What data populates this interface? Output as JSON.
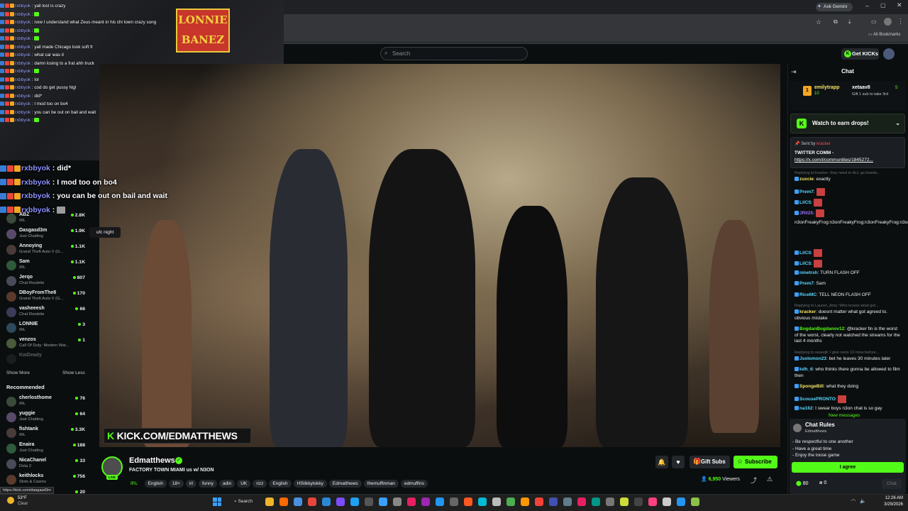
{
  "browser": {
    "ask_gemini": "Ask Gemini",
    "bookmarks_label": "All Bookmarks"
  },
  "kick": {
    "search_placeholder": "Search",
    "get_kicks": "Get KICKs"
  },
  "overlay_chat": [
    {
      "user": "rxbbyok",
      "text": "yall lost is crazy"
    },
    {
      "user": "rxbbyok",
      "text": ""
    },
    {
      "user": "rxbbyok",
      "text": "now I understand what Zeus meant in his chi town crazy song"
    },
    {
      "user": "rxbbyok",
      "text": ""
    },
    {
      "user": "rxbbyok",
      "text": ""
    },
    {
      "user": "rxbbyok",
      "text": "yall made Chicago look soft fr"
    },
    {
      "user": "rxbbyok",
      "text": "what car was it"
    },
    {
      "user": "rxbbyok",
      "text": "damn losing to a frat ahh truck"
    },
    {
      "user": "rxbbyok",
      "text": ""
    },
    {
      "user": "rxbbyok",
      "text": "lol"
    },
    {
      "user": "rxbbyok",
      "text": "cod do get pussy Ngl"
    },
    {
      "user": "rxbbyok",
      "text": "did*"
    },
    {
      "user": "rxbbyok",
      "text": "I mod too on bo4"
    },
    {
      "user": "rxbbyok",
      "text": "you can be out on bail and wait"
    },
    {
      "user": "rxbbyok",
      "text": ""
    }
  ],
  "poster_text": "LONNIE BANEZ",
  "overlay_big": [
    {
      "user": "rxbbyok",
      "text": "did*"
    },
    {
      "user": "rxbbyok",
      "text": "I mod too on bo4"
    },
    {
      "user": "rxbbyok",
      "text": "you can be out on bail and wait"
    },
    {
      "user": "rxbbyok",
      "text": ""
    }
  ],
  "sidebar": {
    "channels": [
      {
        "name": "ABZ",
        "category": "IRL",
        "viewers": "2.8K"
      },
      {
        "name": "Dasgasd3m",
        "category": "Just Chatting",
        "viewers": "1.9K"
      },
      {
        "name": "Annoying",
        "category": "Grand Theft Auto V (G...",
        "viewers": "1.1K"
      },
      {
        "name": "Sam",
        "category": "IRL",
        "viewers": "1.1K"
      },
      {
        "name": "Jerqo",
        "category": "Chat Roulette",
        "viewers": "807"
      },
      {
        "name": "DBoyFromThe8",
        "category": "Grand Theft Auto V (G...",
        "viewers": "170"
      },
      {
        "name": "vasheeesh",
        "category": "Chat Roulette",
        "viewers": "66"
      },
      {
        "name": "LONNIE",
        "category": "IRL",
        "viewers": "3"
      },
      {
        "name": "venzos",
        "category": "Call Of Duty: Modern War...",
        "viewers": "1"
      },
      {
        "name": "KaiDeady",
        "category": "",
        "viewers": ""
      }
    ],
    "show_more": "Show More",
    "show_less": "Show Less",
    "recommended_title": "Recommended",
    "recommended": [
      {
        "name": "cherlosthome",
        "category": "IRL",
        "viewers": "76"
      },
      {
        "name": "yuggie",
        "category": "Just Chatting",
        "viewers": "64"
      },
      {
        "name": "fishtank",
        "category": "IRL",
        "viewers": "3.3K"
      },
      {
        "name": "Enaira",
        "category": "Just Chatting",
        "viewers": "188"
      },
      {
        "name": "NicaChanel",
        "category": "Dota 2",
        "viewers": "33"
      },
      {
        "name": "keithlocks",
        "category": "Slots & Casino",
        "viewers": "756"
      },
      {
        "name": "",
        "category": "",
        "viewers": "20"
      }
    ]
  },
  "tooltip": "ufc night",
  "video": {
    "watermark_k": "K",
    "watermark": "KICK.COM/EDMATTHEWS"
  },
  "stream": {
    "streamer": "Edmatthews",
    "live": "LIVE",
    "title": "FACTORY TOWN MIAMI us w/ N3ON",
    "category": "IRL",
    "tags": [
      "English",
      "18+",
      "irl",
      "funny",
      "adin",
      "UK",
      "rizz",
      "English",
      "HStikkytokky",
      "Edmatthews",
      "themuffinman",
      "edmuffins"
    ],
    "gift_subs": "Gift Subs",
    "subscribe": "Subscribe",
    "viewers_count": "6,950",
    "viewers_label": "Viewers"
  },
  "chat": {
    "title": "Chat",
    "gift_user": "emilytrapp",
    "gift_count": "10",
    "gift_target": "xetaav8",
    "gift_num": "5",
    "gift_text": "Gift 1 sub to take 3rd",
    "drops": "Watch to earn drops!",
    "pinned_sent_by": "Sent by",
    "pinned_user": "kracker",
    "pinned_text": "TWITTER COMM -",
    "pinned_link": "https://x.com/i/communities/1845272...",
    "messages": [
      {
        "reply": "Replying to kracker: they need to ALL go beside..."
      },
      {
        "user": "zuxcie",
        "color": "#f5e663",
        "text": "exactly"
      },
      {
        "user": "Prem7",
        "color": "#58d8ff",
        "text": ""
      },
      {
        "user": "LilCS",
        "color": "#58d8ff",
        "text": ""
      },
      {
        "user": "JR025",
        "color": "#9b6bff",
        "text": ""
      },
      {
        "text": "n3onFreakyFrog:n3onFreakyFrog:n3onFreakyFrog:n3onFreakyFrog:n3onFreakyFrog:n3onFreakyFrog:n3onFreakyFrog:n3onFreakyFrog:n3onFreakyFrog:"
      },
      {
        "user": "LilCS",
        "color": "#58d8ff",
        "text": ""
      },
      {
        "user": "LilCS",
        "color": "#58d8ff",
        "text": ""
      },
      {
        "user": "ninetrsh",
        "color": "#58d8ff",
        "text": "TURN FLASH OFF"
      },
      {
        "user": "Prem7",
        "color": "#58d8ff",
        "text": "Sam"
      },
      {
        "user": "RiceMC",
        "color": "#58d8ff",
        "text": "TELL NEON FLASH OFF"
      },
      {
        "reply": "Replying to Lauren_Amy: Who knows what get..."
      },
      {
        "user": "kracker",
        "color": "#f5e663",
        "text": "doesnt matter what got agreed to. obvious mistake"
      },
      {
        "user": "BogdanBogdanov12",
        "color": "#53fc18",
        "text": "@kracker fin is the worst of the worst, clearly not watched the streams for the last 4 months"
      },
      {
        "reply": "Replying to seanqlt: I give neon 10 mins before..."
      },
      {
        "user": "Jsolomon23",
        "color": "#58d8ff",
        "text": "bet he leaves 30 minutes later"
      },
      {
        "user": "kdh_6",
        "color": "#58d8ff",
        "text": "who thinks there gonna be allowed to film then"
      },
      {
        "user": "SpongeBill",
        "color": "#f5e663",
        "text": "what they doing"
      },
      {
        "user": "ScousePRONTO",
        "color": "#58d8ff",
        "text": ""
      },
      {
        "user": "na162",
        "color": "#58d8ff",
        "text": "I swear boys n3on chat is so gay"
      }
    ],
    "new_messages": "New messages",
    "rules_title": "Chat Rules",
    "rules_owner": "Edmatthews",
    "rules": [
      "- Be respectful to one another",
      "- Have a great time",
      "- Enjoy the loose game"
    ],
    "agree": "I agree",
    "kicks_count": "80",
    "gift_count_bottom": "0",
    "chat_button": "Chat"
  },
  "status_url": "https://kick.com/dasgasd3m",
  "taskbar": {
    "weather_temp": "53°F",
    "weather_text": "Clear",
    "search": "Search",
    "time": "12:26 AM",
    "date": "3/29/2026"
  },
  "colors": {
    "kick_green": "#53fc18",
    "bg": "#0b0e0f"
  }
}
